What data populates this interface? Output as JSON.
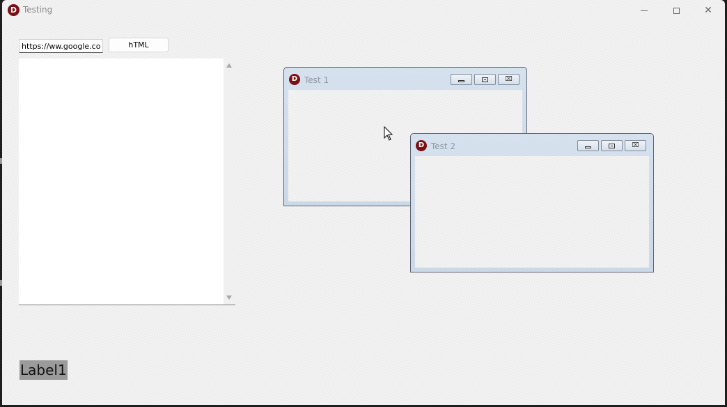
{
  "window": {
    "title": "Testing",
    "logo_letter": "D",
    "controls": {
      "minimize": "",
      "maximize": "",
      "close": "✕"
    }
  },
  "url_input": {
    "value": "https://ww.google.cor"
  },
  "html_button": {
    "label": "hTML"
  },
  "mdi_children": [
    {
      "title": "Test 1",
      "logo_letter": "D"
    },
    {
      "title": "Test 2",
      "logo_letter": "D"
    }
  ],
  "mdi_button_glyphs": {
    "close": "⌧"
  },
  "label1": {
    "text": "Label1"
  },
  "colors": {
    "brand_logo": "#7a0f15",
    "mdi_frame": "#cbd8e8",
    "label_background": "#9b9b9b"
  }
}
